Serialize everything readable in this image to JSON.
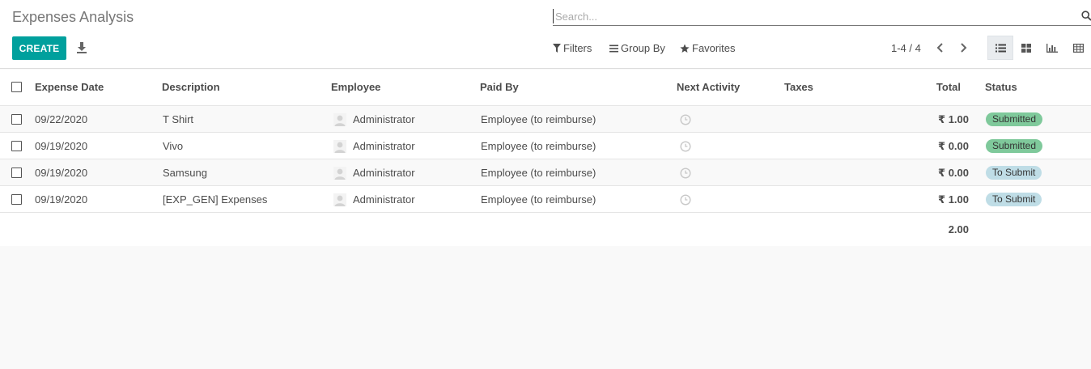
{
  "app": {
    "title": "Expenses Analysis"
  },
  "toolbar": {
    "create_label": "CREATE"
  },
  "search": {
    "placeholder": "Search..."
  },
  "filters": {
    "filters_label": "Filters",
    "group_by_label": "Group By",
    "favorites_label": "Favorites"
  },
  "pager": {
    "range": "1-4 / 4"
  },
  "columns": {
    "expense_date": "Expense Date",
    "description": "Description",
    "employee": "Employee",
    "paid_by": "Paid By",
    "next_activity": "Next Activity",
    "taxes": "Taxes",
    "total": "Total",
    "status": "Status"
  },
  "rows": [
    {
      "date": "09/22/2020",
      "description": "T Shirt",
      "employee": "Administrator",
      "paid_by": "Employee (to reimburse)",
      "total": "₹ 1.00",
      "status": "Submitted",
      "status_type": "submitted"
    },
    {
      "date": "09/19/2020",
      "description": "Vivo",
      "employee": "Administrator",
      "paid_by": "Employee (to reimburse)",
      "total": "₹ 0.00",
      "status": "Submitted",
      "status_type": "submitted"
    },
    {
      "date": "09/19/2020",
      "description": "Samsung",
      "employee": "Administrator",
      "paid_by": "Employee (to reimburse)",
      "total": "₹ 0.00",
      "status": "To Submit",
      "status_type": "to_submit"
    },
    {
      "date": "09/19/2020",
      "description": "[EXP_GEN] Expenses",
      "employee": "Administrator",
      "paid_by": "Employee (to reimburse)",
      "total": "₹ 1.00",
      "status": "To Submit",
      "status_type": "to_submit"
    }
  ],
  "footer": {
    "total_sum": "2.00"
  },
  "colors": {
    "accent": "#00a09d",
    "status_submitted": "#7fc99b",
    "status_to_submit": "#bfdde6"
  }
}
